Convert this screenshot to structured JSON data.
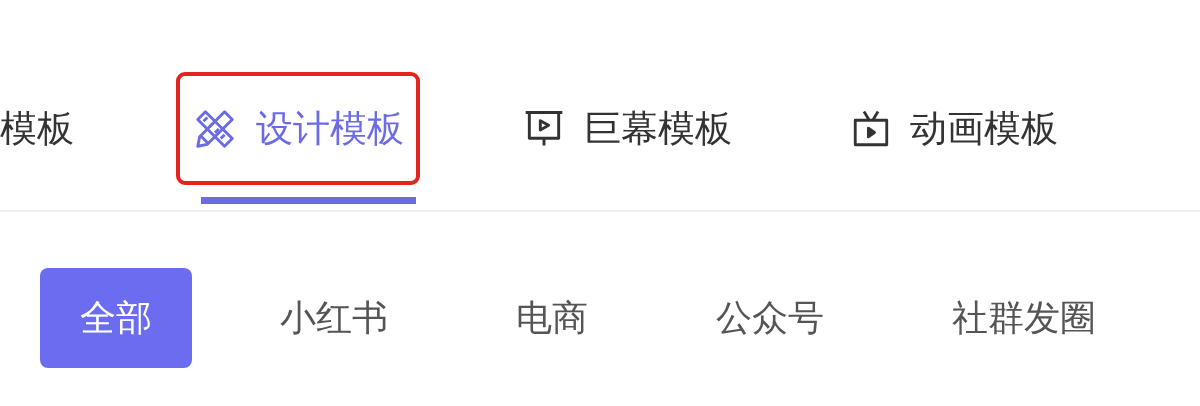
{
  "tabs": [
    {
      "label": "模板",
      "kind": "plain",
      "selected": false,
      "highlighted": false
    },
    {
      "label": "设计模板",
      "kind": "design",
      "selected": true,
      "highlighted": true
    },
    {
      "label": "巨幕模板",
      "kind": "screen",
      "selected": false,
      "highlighted": false
    },
    {
      "label": "动画模板",
      "kind": "animation",
      "selected": false,
      "highlighted": false
    }
  ],
  "filters": [
    {
      "label": "全部",
      "selected": true
    },
    {
      "label": "小红书",
      "selected": false
    },
    {
      "label": "电商",
      "selected": false
    },
    {
      "label": "公众号",
      "selected": false
    },
    {
      "label": "社群发圈",
      "selected": false
    }
  ]
}
